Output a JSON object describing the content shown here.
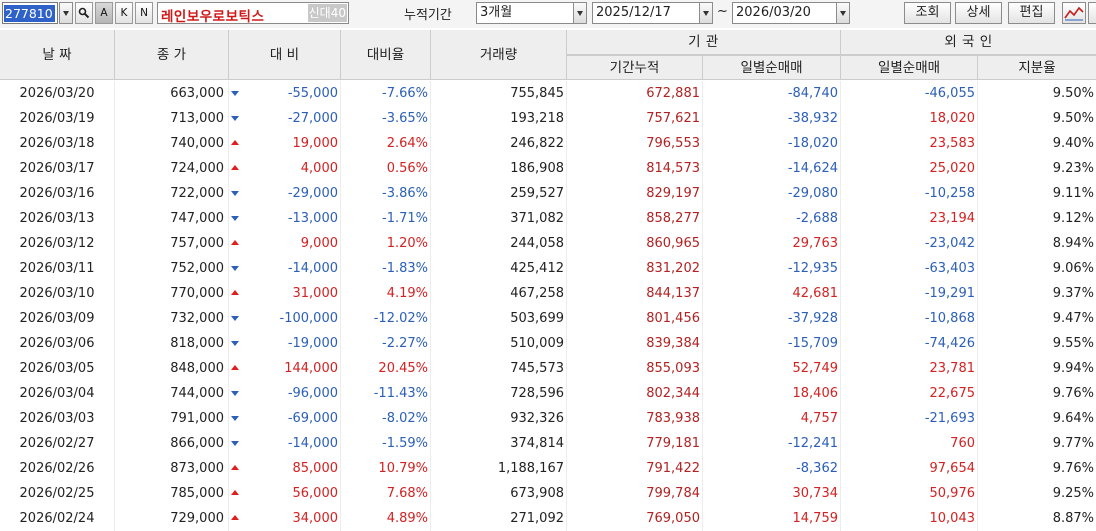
{
  "toolbar": {
    "stock_code": "277810",
    "btn_search_icon": "magnifier-icon",
    "btn_a": "A",
    "btn_k": "K",
    "btn_n": "N",
    "stock_name": "레인보우로보틱스",
    "badge": "신대40",
    "period_label": "누적기간",
    "period_value": "3개월",
    "date_from": "2025/12/17",
    "tilde": "~",
    "date_to": "2026/03/20",
    "btn_query": "조회",
    "btn_detail": "상세",
    "btn_edit": "편집",
    "btn_chart_icon": "line-chart-icon"
  },
  "header": {
    "date": "날 짜",
    "close": "종 가",
    "diff": "대 비",
    "rate": "대비율",
    "volume": "거래량",
    "institution": "기 관",
    "inst_cum": "기간누적",
    "inst_daily": "일별순매매",
    "foreign": "외 국 인",
    "frn_daily": "일별순매매",
    "share": "지분율"
  },
  "colors": {
    "up": "#d42121",
    "down": "#2b5fb8",
    "header_bg": "#eeeeee",
    "selected_code_bg": "#2f62c8"
  },
  "rows": [
    {
      "date": "2026/03/20",
      "close": "663,000",
      "dir": "dn",
      "diff": "-55,000",
      "rate": "-7.66%",
      "volume": "755,845",
      "inst_cum": "672,881",
      "inst_net": "-84,740",
      "frn_net": "-46,055",
      "share": "9.50%"
    },
    {
      "date": "2026/03/19",
      "close": "713,000",
      "dir": "dn",
      "diff": "-27,000",
      "rate": "-3.65%",
      "volume": "193,218",
      "inst_cum": "757,621",
      "inst_net": "-38,932",
      "frn_net": "18,020",
      "share": "9.50%"
    },
    {
      "date": "2026/03/18",
      "close": "740,000",
      "dir": "up",
      "diff": "19,000",
      "rate": "2.64%",
      "volume": "246,822",
      "inst_cum": "796,553",
      "inst_net": "-18,020",
      "frn_net": "23,583",
      "share": "9.40%"
    },
    {
      "date": "2026/03/17",
      "close": "724,000",
      "dir": "up",
      "diff": "4,000",
      "rate": "0.56%",
      "volume": "186,908",
      "inst_cum": "814,573",
      "inst_net": "-14,624",
      "frn_net": "25,020",
      "share": "9.23%"
    },
    {
      "date": "2026/03/16",
      "close": "722,000",
      "dir": "dn",
      "diff": "-29,000",
      "rate": "-3.86%",
      "volume": "259,527",
      "inst_cum": "829,197",
      "inst_net": "-29,080",
      "frn_net": "-10,258",
      "share": "9.11%"
    },
    {
      "date": "2026/03/13",
      "close": "747,000",
      "dir": "dn",
      "diff": "-13,000",
      "rate": "-1.71%",
      "volume": "371,082",
      "inst_cum": "858,277",
      "inst_net": "-2,688",
      "frn_net": "23,194",
      "share": "9.12%"
    },
    {
      "date": "2026/03/12",
      "close": "757,000",
      "dir": "up",
      "diff": "9,000",
      "rate": "1.20%",
      "volume": "244,058",
      "inst_cum": "860,965",
      "inst_net": "29,763",
      "frn_net": "-23,042",
      "share": "8.94%"
    },
    {
      "date": "2026/03/11",
      "close": "752,000",
      "dir": "dn",
      "diff": "-14,000",
      "rate": "-1.83%",
      "volume": "425,412",
      "inst_cum": "831,202",
      "inst_net": "-12,935",
      "frn_net": "-63,403",
      "share": "9.06%"
    },
    {
      "date": "2026/03/10",
      "close": "770,000",
      "dir": "up",
      "diff": "31,000",
      "rate": "4.19%",
      "volume": "467,258",
      "inst_cum": "844,137",
      "inst_net": "42,681",
      "frn_net": "-19,291",
      "share": "9.37%"
    },
    {
      "date": "2026/03/09",
      "close": "732,000",
      "dir": "dn",
      "diff": "-100,000",
      "rate": "-12.02%",
      "volume": "503,699",
      "inst_cum": "801,456",
      "inst_net": "-37,928",
      "frn_net": "-10,868",
      "share": "9.47%"
    },
    {
      "date": "2026/03/06",
      "close": "818,000",
      "dir": "dn",
      "diff": "-19,000",
      "rate": "-2.27%",
      "volume": "510,009",
      "inst_cum": "839,384",
      "inst_net": "-15,709",
      "frn_net": "-74,426",
      "share": "9.55%"
    },
    {
      "date": "2026/03/05",
      "close": "848,000",
      "dir": "up",
      "diff": "144,000",
      "rate": "20.45%",
      "volume": "745,573",
      "inst_cum": "855,093",
      "inst_net": "52,749",
      "frn_net": "23,781",
      "share": "9.94%"
    },
    {
      "date": "2026/03/04",
      "close": "744,000",
      "dir": "dn",
      "diff": "-96,000",
      "rate": "-11.43%",
      "volume": "728,596",
      "inst_cum": "802,344",
      "inst_net": "18,406",
      "frn_net": "22,675",
      "share": "9.76%"
    },
    {
      "date": "2026/03/03",
      "close": "791,000",
      "dir": "dn",
      "diff": "-69,000",
      "rate": "-8.02%",
      "volume": "932,326",
      "inst_cum": "783,938",
      "inst_net": "4,757",
      "frn_net": "-21,693",
      "share": "9.64%"
    },
    {
      "date": "2026/02/27",
      "close": "866,000",
      "dir": "dn",
      "diff": "-14,000",
      "rate": "-1.59%",
      "volume": "374,814",
      "inst_cum": "779,181",
      "inst_net": "-12,241",
      "frn_net": "760",
      "share": "9.77%"
    },
    {
      "date": "2026/02/26",
      "close": "873,000",
      "dir": "up",
      "diff": "85,000",
      "rate": "10.79%",
      "volume": "1,188,167",
      "inst_cum": "791,422",
      "inst_net": "-8,362",
      "frn_net": "97,654",
      "share": "9.76%"
    },
    {
      "date": "2026/02/25",
      "close": "785,000",
      "dir": "up",
      "diff": "56,000",
      "rate": "7.68%",
      "volume": "673,908",
      "inst_cum": "799,784",
      "inst_net": "30,734",
      "frn_net": "50,976",
      "share": "9.25%"
    },
    {
      "date": "2026/02/24",
      "close": "729,000",
      "dir": "up",
      "diff": "34,000",
      "rate": "4.89%",
      "volume": "271,092",
      "inst_cum": "769,050",
      "inst_net": "14,759",
      "frn_net": "10,043",
      "share": "8.87%"
    }
  ]
}
